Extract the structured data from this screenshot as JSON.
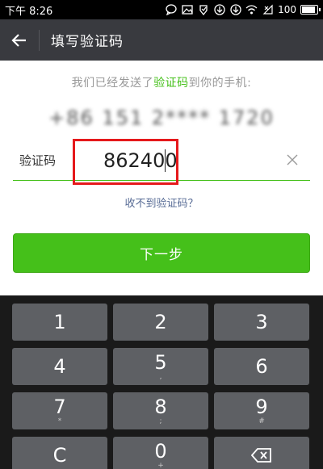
{
  "status_bar": {
    "time": "下午 8:26",
    "battery_text": "100",
    "battery_level": 1.0,
    "icons": [
      "chat-bubble-icon",
      "image-icon",
      "download-icon",
      "download-icon",
      "wifi-icon",
      "close-signal-icon",
      "battery-icon"
    ]
  },
  "header": {
    "back_icon": "arrow-left-icon",
    "title": "填写验证码"
  },
  "main": {
    "hint_prefix": "我们已经发送了",
    "hint_accent": "验证码",
    "hint_suffix": "到你的手机:",
    "phone_masked": "+86 151 2**** 1720",
    "code_label": "验证码",
    "code_value": "862400",
    "no_code_link": "收不到验证码？",
    "next_button": "下一步"
  },
  "keyboard": {
    "keys": [
      {
        "main": "1",
        "sub": ""
      },
      {
        "main": "2",
        "sub": ""
      },
      {
        "main": "3",
        "sub": ""
      },
      {
        "main": "4",
        "sub": ""
      },
      {
        "main": "5",
        "sub": ","
      },
      {
        "main": "6",
        "sub": ""
      },
      {
        "main": "7",
        "sub": "*"
      },
      {
        "main": "8",
        "sub": ";"
      },
      {
        "main": "9",
        "sub": "#"
      },
      {
        "main": "C",
        "sub": ""
      },
      {
        "main": "0",
        "sub": "+"
      },
      {
        "main": "",
        "sub": "",
        "icon": "backspace-icon"
      }
    ]
  },
  "colors": {
    "accent_green": "#45c01a",
    "title_bar": "#393a3f",
    "highlight_red": "#e5191c",
    "link_blue": "#576b95",
    "key_gray": "#5e6064",
    "keyboard_bg": "#1a1a1a"
  }
}
